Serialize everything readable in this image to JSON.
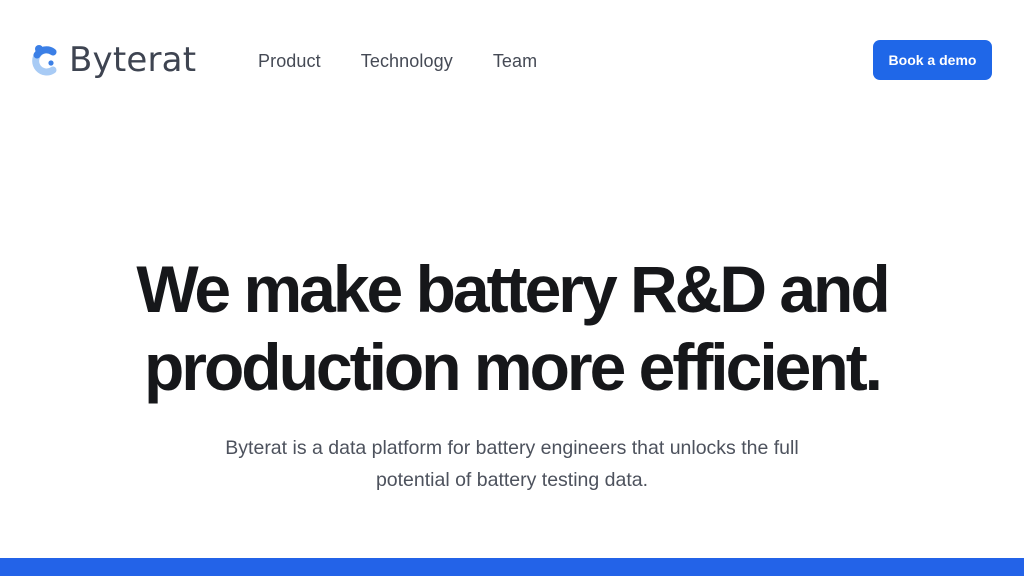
{
  "brand": {
    "name": "Byterat",
    "icon": "byterat-logo-icon",
    "colors": {
      "mark_light": "#9ac3f4",
      "mark_dark": "#3b7fe6",
      "text": "#3e4451"
    }
  },
  "nav": {
    "items": [
      {
        "label": "Product"
      },
      {
        "label": "Technology"
      },
      {
        "label": "Team"
      }
    ]
  },
  "cta": {
    "label": "Book a demo",
    "color": "#1f67e8"
  },
  "hero": {
    "title_line1": "We make battery R&D and",
    "title_line2": "production more efficient.",
    "subtitle": "Byterat is a data platform for battery engineers that unlocks the full potential of battery testing data."
  },
  "colors": {
    "accent": "#1f67e8",
    "heading": "#16171a",
    "body": "#4d525d",
    "band": "#2363e8"
  }
}
